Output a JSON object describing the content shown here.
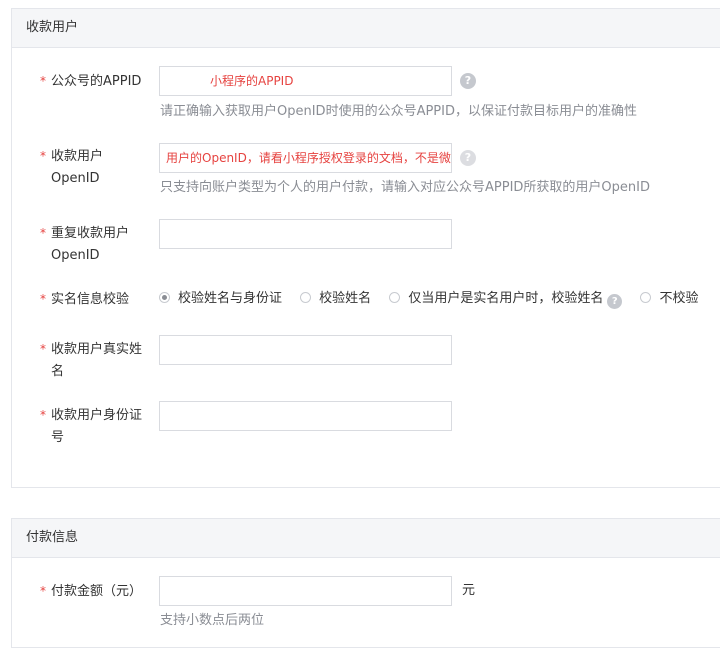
{
  "payee_section": {
    "title": "收款用户",
    "appid": {
      "label": "公众号的APPID",
      "value": "小程序的APPID",
      "hint": "请正确输入获取用户OpenID时使用的公众号APPID，以保证付款目标用户的准确性",
      "help_icon": "?"
    },
    "openid": {
      "label_line1": "收款用户",
      "label_line2": "OpenID",
      "value": "用户的OpenID，请看小程序授权登录的文档，不是微信号哈",
      "hint": "只支持向账户类型为个人的用户付款，请输入对应公众号APPID所获取的用户OpenID",
      "help_icon": "?"
    },
    "repeat_openid": {
      "label_line1": "重复收款用户",
      "label_line2": "OpenID",
      "value": ""
    },
    "realname_check": {
      "label": "实名信息校验",
      "options": [
        {
          "label": "校验姓名与身份证",
          "selected": true
        },
        {
          "label": "校验姓名",
          "selected": false
        },
        {
          "label": "仅当用户是实名用户时，校验姓名",
          "selected": false
        },
        {
          "label": "不校验",
          "selected": false
        }
      ],
      "help_icon": "?"
    },
    "real_name": {
      "label_line1": "收款用户真实姓",
      "label_line2": "名",
      "value": ""
    },
    "id_number": {
      "label_line1": "收款用户身份证",
      "label_line2": "号",
      "value": ""
    }
  },
  "payment_section": {
    "title": "付款信息",
    "amount": {
      "label": "付款金额（元）",
      "value": "",
      "unit": "元",
      "hint": "支持小数点后两位"
    }
  },
  "required_mark": "*"
}
